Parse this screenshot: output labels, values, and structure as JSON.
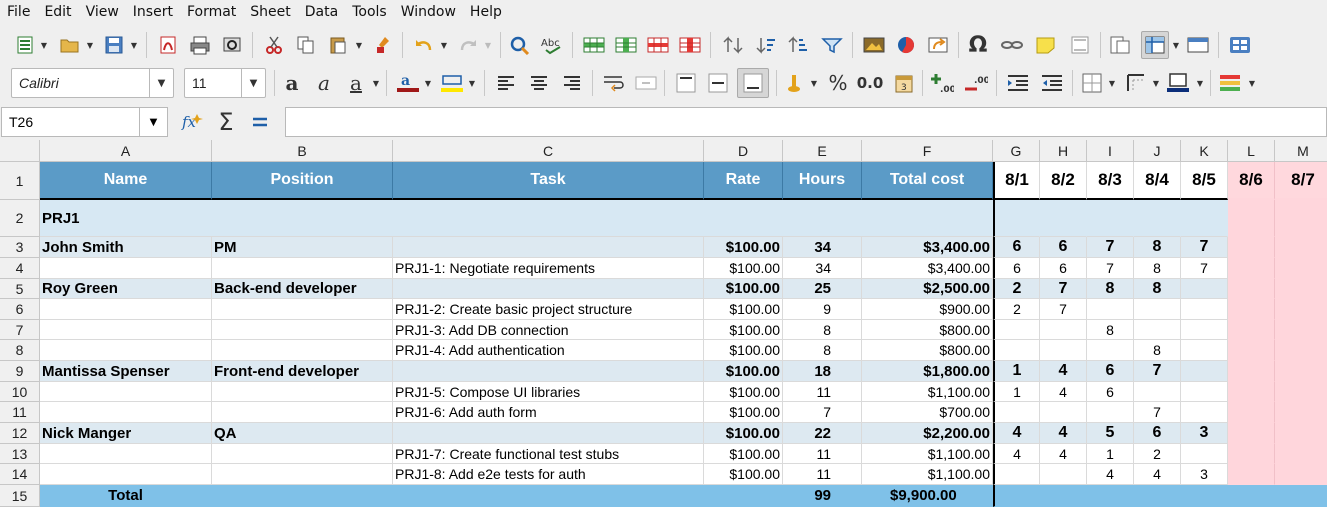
{
  "menu": [
    "File",
    "Edit",
    "View",
    "Insert",
    "Format",
    "Sheet",
    "Data",
    "Tools",
    "Window",
    "Help"
  ],
  "toolbar": {
    "font_name": "Calibri",
    "font_size": "11",
    "percent_label": "%",
    "decimal_label": "0.0"
  },
  "formula_bar": {
    "cell_ref": "T26",
    "formula": ""
  },
  "columns": [
    "A",
    "B",
    "C",
    "D",
    "E",
    "F",
    "G",
    "H",
    "I",
    "J",
    "K",
    "L",
    "M"
  ],
  "rows": [
    "1",
    "2",
    "3",
    "4",
    "5",
    "6",
    "7",
    "8",
    "9",
    "10",
    "11",
    "12",
    "13",
    "14",
    "15"
  ],
  "sheet": {
    "headers": {
      "name": "Name",
      "position": "Position",
      "task": "Task",
      "rate": "Rate",
      "hours": "Hours",
      "total_cost": "Total cost",
      "dates": [
        "8/1",
        "8/2",
        "8/3",
        "8/4",
        "8/5",
        "8/6",
        "8/7"
      ]
    },
    "project": "PRJ1",
    "lines": [
      {
        "kind": "person",
        "name": "John Smith",
        "position": "PM",
        "task": "",
        "rate": "$100.00",
        "hours": "34",
        "cost": "$3,400.00",
        "days": [
          "6",
          "6",
          "7",
          "8",
          "7",
          "",
          ""
        ]
      },
      {
        "kind": "task",
        "name": "",
        "position": "",
        "task": "PRJ1-1: Negotiate requirements",
        "rate": "$100.00",
        "hours": "34",
        "cost": "$3,400.00",
        "days": [
          "6",
          "6",
          "7",
          "8",
          "7",
          "",
          ""
        ]
      },
      {
        "kind": "person",
        "name": "Roy Green",
        "position": "Back-end developer",
        "task": "",
        "rate": "$100.00",
        "hours": "25",
        "cost": "$2,500.00",
        "days": [
          "2",
          "7",
          "8",
          "8",
          "",
          "",
          ""
        ]
      },
      {
        "kind": "task",
        "name": "",
        "position": "",
        "task": "PRJ1-2: Create basic project structure",
        "rate": "$100.00",
        "hours": "9",
        "cost": "$900.00",
        "days": [
          "2",
          "7",
          "",
          "",
          "",
          "",
          ""
        ]
      },
      {
        "kind": "task",
        "name": "",
        "position": "",
        "task": "PRJ1-3: Add DB connection",
        "rate": "$100.00",
        "hours": "8",
        "cost": "$800.00",
        "days": [
          "",
          "",
          "8",
          "",
          "",
          "",
          ""
        ]
      },
      {
        "kind": "task",
        "name": "",
        "position": "",
        "task": "PRJ1-4: Add authentication",
        "rate": "$100.00",
        "hours": "8",
        "cost": "$800.00",
        "days": [
          "",
          "",
          "",
          "8",
          "",
          "",
          ""
        ]
      },
      {
        "kind": "person",
        "name": "Mantissa Spenser",
        "position": "Front-end developer",
        "task": "",
        "rate": "$100.00",
        "hours": "18",
        "cost": "$1,800.00",
        "days": [
          "1",
          "4",
          "6",
          "7",
          "",
          "",
          ""
        ]
      },
      {
        "kind": "task",
        "name": "",
        "position": "",
        "task": "PRJ1-5: Compose UI libraries",
        "rate": "$100.00",
        "hours": "11",
        "cost": "$1,100.00",
        "days": [
          "1",
          "4",
          "6",
          "",
          "",
          "",
          ""
        ]
      },
      {
        "kind": "task",
        "name": "",
        "position": "",
        "task": "PRJ1-6: Add auth form",
        "rate": "$100.00",
        "hours": "7",
        "cost": "$700.00",
        "days": [
          "",
          "",
          "",
          "7",
          "",
          "",
          ""
        ]
      },
      {
        "kind": "person",
        "name": "Nick Manger",
        "position": "QA",
        "task": "",
        "rate": "$100.00",
        "hours": "22",
        "cost": "$2,200.00",
        "days": [
          "4",
          "4",
          "5",
          "6",
          "3",
          "",
          ""
        ]
      },
      {
        "kind": "task",
        "name": "",
        "position": "",
        "task": "PRJ1-7: Create functional test stubs",
        "rate": "$100.00",
        "hours": "11",
        "cost": "$1,100.00",
        "days": [
          "4",
          "4",
          "1",
          "2",
          "",
          "",
          ""
        ]
      },
      {
        "kind": "task",
        "name": "",
        "position": "",
        "task": "PRJ1-8: Add e2e tests for auth",
        "rate": "$100.00",
        "hours": "11",
        "cost": "$1,100.00",
        "days": [
          "",
          "",
          "4",
          "4",
          "3",
          "",
          ""
        ]
      }
    ],
    "total": {
      "label": "Total",
      "hours": "99",
      "cost": "$9,900.00"
    }
  },
  "colors": {
    "header_blue": "#5b9bc7",
    "project_band": "#d7e8f3",
    "person_band": "#dde9f1",
    "weekend_pink": "#ffd6dc",
    "total_blue": "#7fc1e8"
  }
}
